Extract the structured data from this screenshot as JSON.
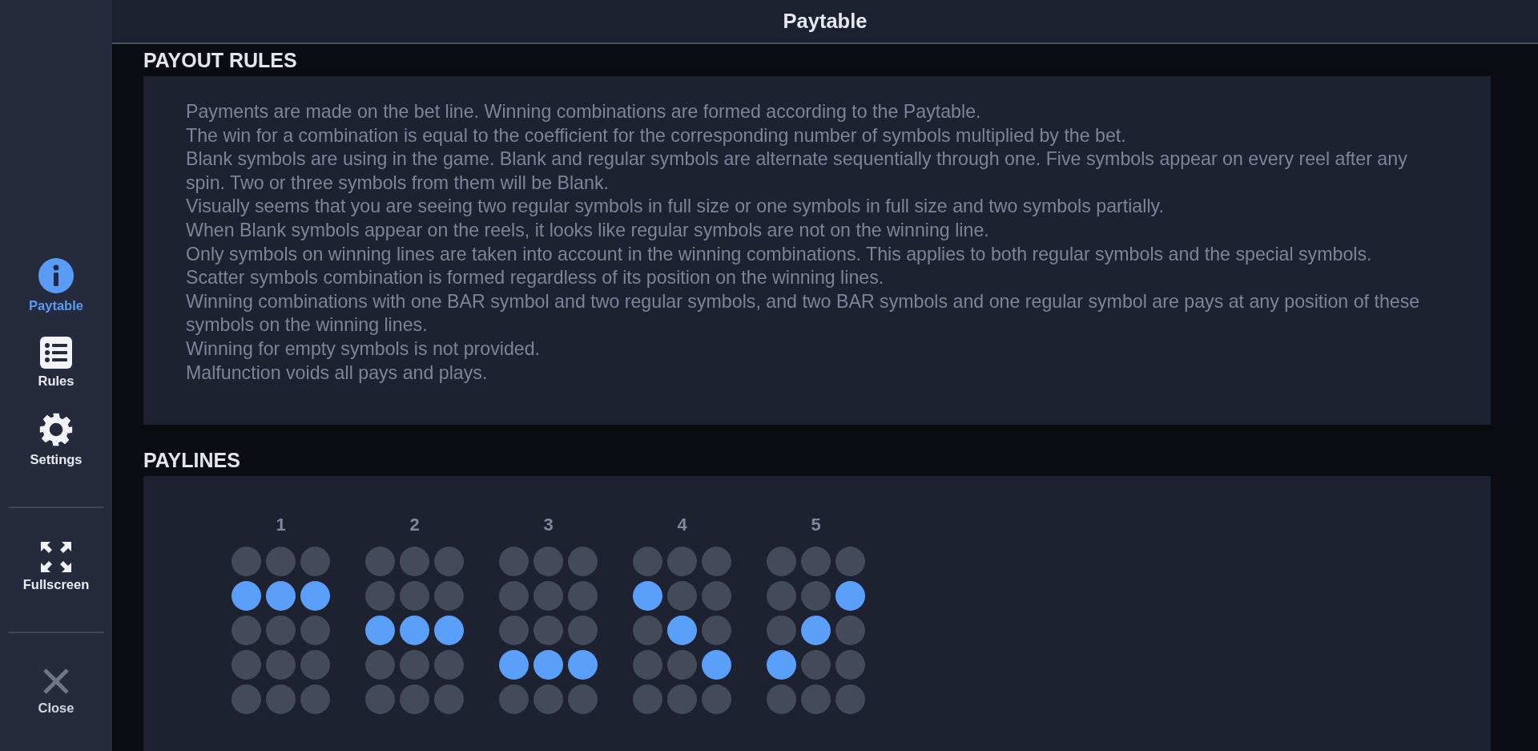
{
  "header": {
    "title": "Paytable"
  },
  "sidebar": {
    "items": [
      {
        "label": "Paytable",
        "kind": "info",
        "selected": true
      },
      {
        "label": "Rules",
        "kind": "list",
        "selected": false
      },
      {
        "label": "Settings",
        "kind": "gear",
        "selected": false
      },
      {
        "label": "Fullscreen",
        "kind": "fullscreen",
        "selected": false
      },
      {
        "label": "Close",
        "kind": "close",
        "selected": false
      }
    ]
  },
  "sections": [
    {
      "kind": "text",
      "title": "PAYOUT RULES",
      "paragraphs": [
        "Payments are made on the bet line. Winning combinations are formed according to the Paytable.",
        "The win for a combination is equal to the coefficient for the corresponding number of symbols multiplied by the bet.",
        "Blank symbols are using in the game. Blank and regular symbols are alternate sequentially through one. Five symbols appear on every reel after any spin. Two or three symbols from them will be Blank.",
        "Visually seems that you are seeing two regular symbols in full size or one symbols in full size and two symbols partially.",
        "When Blank symbols appear on the reels, it looks like regular symbols are not on the winning line.",
        "Only symbols on winning lines are taken into account in the winning combinations. This applies to both regular symbols and the special symbols.",
        "Scatter symbols combination is formed regardless of its position on the winning lines.",
        "Winning combinations with one BAR symbol and two regular symbols, and two BAR symbols and one regular symbol are pays at any position of these symbols on the winning lines.",
        "Winning for empty symbols is not provided.",
        "Malfunction voids all pays and plays."
      ]
    },
    {
      "kind": "paylines",
      "title": "PAYLINES",
      "lines": [
        {
          "number": "1",
          "rows": [
            [
              false,
              false,
              false
            ],
            [
              true,
              true,
              true
            ],
            [
              false,
              false,
              false
            ],
            [
              false,
              false,
              false
            ],
            [
              false,
              false,
              false
            ]
          ]
        },
        {
          "number": "2",
          "rows": [
            [
              false,
              false,
              false
            ],
            [
              false,
              false,
              false
            ],
            [
              true,
              true,
              true
            ],
            [
              false,
              false,
              false
            ],
            [
              false,
              false,
              false
            ]
          ]
        },
        {
          "number": "3",
          "rows": [
            [
              false,
              false,
              false
            ],
            [
              false,
              false,
              false
            ],
            [
              false,
              false,
              false
            ],
            [
              true,
              true,
              true
            ],
            [
              false,
              false,
              false
            ]
          ]
        },
        {
          "number": "4",
          "rows": [
            [
              false,
              false,
              false
            ],
            [
              true,
              false,
              false
            ],
            [
              false,
              true,
              false
            ],
            [
              false,
              false,
              true
            ],
            [
              false,
              false,
              false
            ]
          ]
        },
        {
          "number": "5",
          "rows": [
            [
              false,
              false,
              false
            ],
            [
              false,
              false,
              true
            ],
            [
              false,
              true,
              false
            ],
            [
              true,
              false,
              false
            ],
            [
              false,
              false,
              false
            ]
          ]
        }
      ]
    }
  ]
}
